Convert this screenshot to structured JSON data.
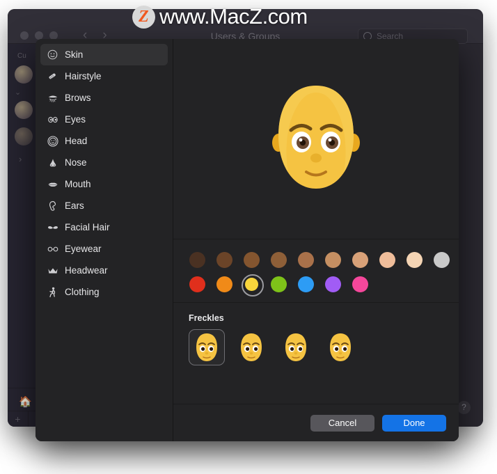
{
  "watermark": {
    "logo_letter": "Z",
    "text": "www.MacZ.com"
  },
  "background_window": {
    "title": "Users & Groups",
    "traffic_lights": [
      "close",
      "minimize",
      "zoom"
    ],
    "nav": {
      "back": "‹",
      "forward": "›"
    },
    "search": {
      "placeholder": "Search",
      "value": ""
    },
    "sidebar": {
      "group_label": "Cu",
      "chevron": "⌄",
      "disclosure": "›",
      "home_icon": "home-icon",
      "add_label": "+",
      "lock_icon": "lock-icon"
    },
    "help_label": "?"
  },
  "sheet": {
    "categories": [
      {
        "label": "Skin",
        "icon": "face-icon",
        "selected": true
      },
      {
        "label": "Hairstyle",
        "icon": "comb-icon",
        "selected": false
      },
      {
        "label": "Brows",
        "icon": "eyebrow-icon",
        "selected": false
      },
      {
        "label": "Eyes",
        "icon": "eyes-icon",
        "selected": false
      },
      {
        "label": "Head",
        "icon": "head-icon",
        "selected": false
      },
      {
        "label": "Nose",
        "icon": "nose-icon",
        "selected": false
      },
      {
        "label": "Mouth",
        "icon": "mouth-icon",
        "selected": false
      },
      {
        "label": "Ears",
        "icon": "ear-icon",
        "selected": false
      },
      {
        "label": "Facial Hair",
        "icon": "mustache-icon",
        "selected": false
      },
      {
        "label": "Eyewear",
        "icon": "glasses-icon",
        "selected": false
      },
      {
        "label": "Headwear",
        "icon": "crown-icon",
        "selected": false
      },
      {
        "label": "Clothing",
        "icon": "person-icon",
        "selected": false
      }
    ],
    "preview": {
      "name": "memoji-preview",
      "skin_color": "#f5c342"
    },
    "skin_tones": {
      "row1": [
        {
          "color": "#4a3122",
          "selected": false
        },
        {
          "color": "#6b4428",
          "selected": false
        },
        {
          "color": "#84552f",
          "selected": false
        },
        {
          "color": "#8e5f38",
          "selected": false
        },
        {
          "color": "#a9714a",
          "selected": false
        },
        {
          "color": "#c58f62",
          "selected": false
        },
        {
          "color": "#d8a178",
          "selected": false
        },
        {
          "color": "#efbd9a",
          "selected": false
        },
        {
          "color": "#f4d4b4",
          "selected": false
        },
        {
          "color": "#c9c9c9",
          "selected": false
        }
      ],
      "row2": [
        {
          "color": "#e02f1c",
          "selected": false
        },
        {
          "color": "#f08a18",
          "selected": false
        },
        {
          "color": "#f8d53c",
          "selected": true
        },
        {
          "color": "#7ec219",
          "selected": false
        },
        {
          "color": "#2d9cf5",
          "selected": false
        },
        {
          "color": "#a15cf5",
          "selected": false
        },
        {
          "color": "#f5479b",
          "selected": false
        }
      ]
    },
    "freckles": {
      "title": "Freckles",
      "options": [
        {
          "name": "freckles-none",
          "selected": true
        },
        {
          "name": "freckles-light",
          "selected": false
        },
        {
          "name": "freckles-medium",
          "selected": false
        },
        {
          "name": "freckles-heavy",
          "selected": false
        }
      ]
    },
    "footer": {
      "cancel_label": "Cancel",
      "done_label": "Done"
    }
  }
}
